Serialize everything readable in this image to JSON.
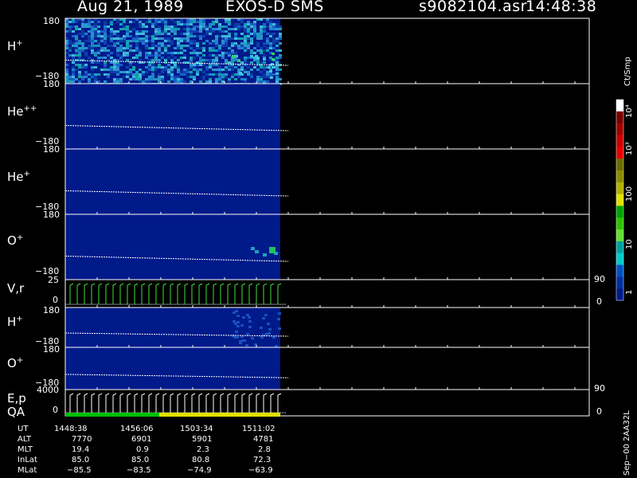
{
  "header": {
    "date": "Aug 21, 1989",
    "mission": "EXOS-D SMS",
    "file": "s9082104.asr",
    "time": "14:48:38"
  },
  "panels": [
    {
      "id": "h_plus",
      "species": "H",
      "charge": "+",
      "ytop": "180",
      "ybot": "−180"
    },
    {
      "id": "he_pp",
      "species": "He",
      "charge": "++",
      "ytop": "180",
      "ybot": "−180"
    },
    {
      "id": "he_plus",
      "species": "He",
      "charge": "+",
      "ytop": "180",
      "ybot": "−180"
    },
    {
      "id": "o_plus",
      "species": "O",
      "charge": "+",
      "ytop": "180",
      "ybot": "−180"
    },
    {
      "id": "vr",
      "species": "V,r",
      "charge": "",
      "ytop": "25",
      "ybot": "0",
      "rtop": "90",
      "rbot": "0"
    },
    {
      "id": "h_plus2",
      "species": "H",
      "charge": "+",
      "ytop": "180",
      "ybot": "−180"
    },
    {
      "id": "o_plus2",
      "species": "O",
      "charge": "+",
      "ytop": "180",
      "ybot": "−180"
    },
    {
      "id": "ep",
      "species": "E,p",
      "charge": "",
      "species2": "QA",
      "ytop": "4000",
      "ybot": "0",
      "rtop": "90",
      "rbot": "0"
    }
  ],
  "colorbar": {
    "units": "Ct/Smp",
    "ticks": [
      "10⁴",
      "10³",
      "100",
      "10",
      "1"
    ],
    "colors": [
      "#ffffff",
      "#7a0000",
      "#a00000",
      "#c80000",
      "#e60000",
      "#6b6b00",
      "#8a8a00",
      "#b0b000",
      "#e0e000",
      "#00a000",
      "#30c000",
      "#60e030",
      "#00a0a0",
      "#00c8c8",
      "#0050c0",
      "#0030a0",
      "#001c8a"
    ]
  },
  "ephemeris": {
    "rows": [
      {
        "label": "UT",
        "values": [
          "1448:38",
          "1456:06",
          "1503:34",
          "1511:02"
        ]
      },
      {
        "label": "ALT",
        "values": [
          "7770",
          "6901",
          "5901",
          "4781"
        ]
      },
      {
        "label": "MLT",
        "values": [
          "19.4",
          "0.9",
          "2.3",
          "2.8"
        ]
      },
      {
        "label": "InLat",
        "values": [
          "85.0",
          "85.0",
          "80.8",
          "72.3"
        ]
      },
      {
        "label": "MLat",
        "values": [
          "−85.5",
          "−83.5",
          "−74.9",
          "−63.9"
        ]
      }
    ]
  },
  "footer_note": "Sep−00 2AA32L",
  "chart_data": {
    "type": "heatmap",
    "title": "Aug 21, 1989   EXOS-D SMS",
    "subtitle": "s9082104.asr  14:48:38",
    "x_time_ticks": [
      "1448:38",
      "1456:06",
      "1503:34",
      "1511:02"
    ],
    "data_coverage_end_fraction": 0.4,
    "y_range_angle": [
      -180,
      180
    ],
    "series": [
      {
        "name": "H+",
        "ylim": [
          -180,
          180
        ]
      },
      {
        "name": "He++",
        "ylim": [
          -180,
          180
        ]
      },
      {
        "name": "He+",
        "ylim": [
          -180,
          180
        ]
      },
      {
        "name": "O+",
        "ylim": [
          -180,
          180
        ]
      },
      {
        "name": "V,r",
        "ylim": [
          0,
          25
        ],
        "right_ylim": [
          0,
          90
        ]
      },
      {
        "name": "H+",
        "ylim": [
          -180,
          180
        ]
      },
      {
        "name": "O+",
        "ylim": [
          -180,
          180
        ]
      },
      {
        "name": "E,p",
        "ylim": [
          0,
          4000
        ],
        "right_ylim": [
          0,
          90
        ]
      }
    ],
    "colorscale": "log 1 to 10^4 Ct/Smp",
    "qa_colors": [
      "#00c000",
      "#e0e000"
    ]
  }
}
